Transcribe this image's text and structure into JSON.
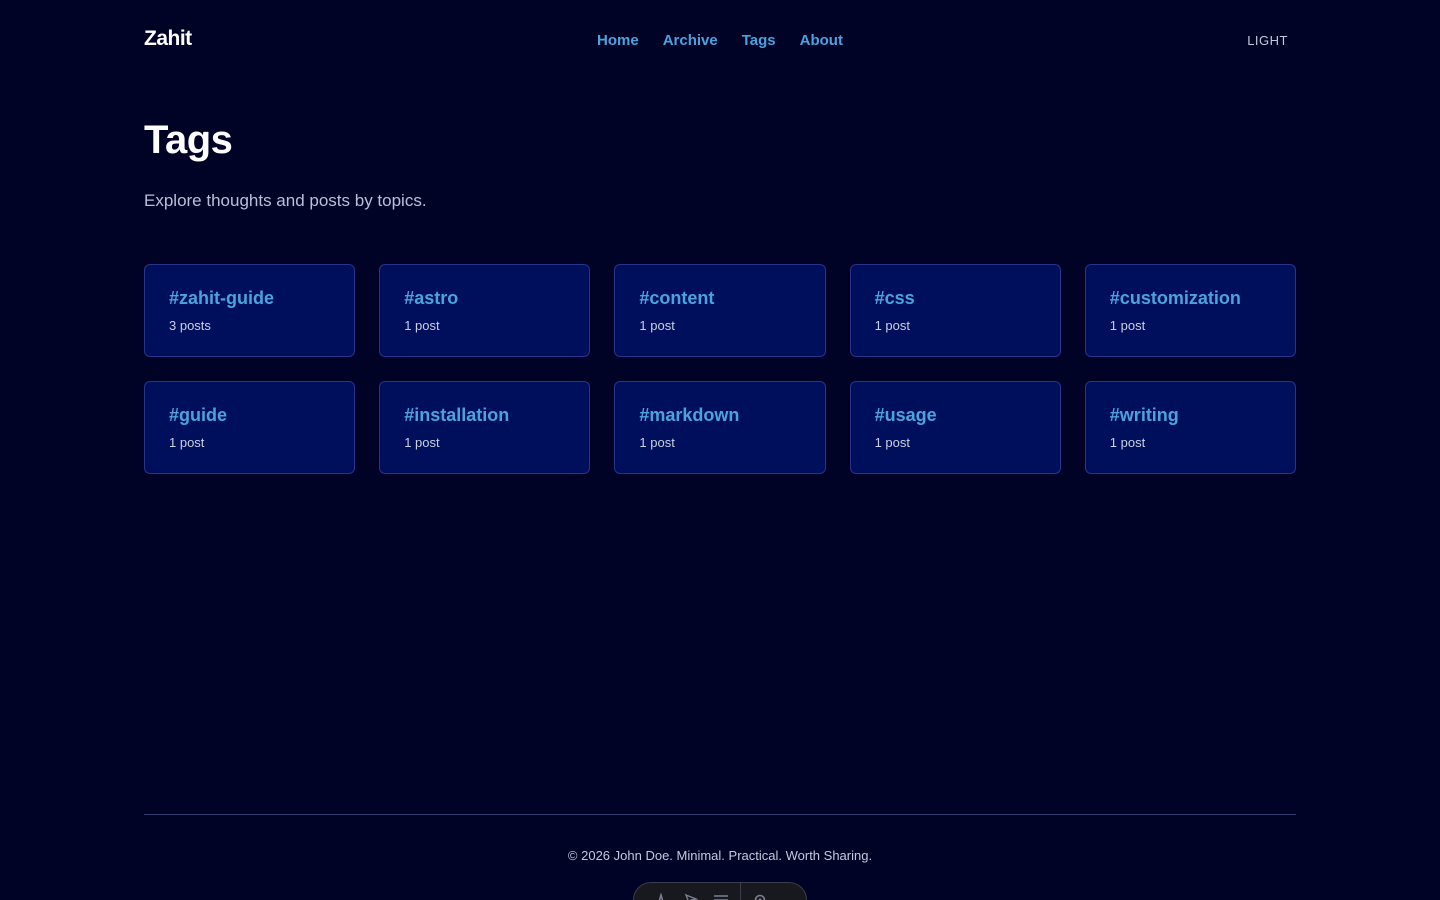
{
  "header": {
    "brand": "Zahit",
    "nav": [
      {
        "label": "Home"
      },
      {
        "label": "Archive"
      },
      {
        "label": "Tags"
      },
      {
        "label": "About"
      }
    ],
    "theme_toggle": "LIGHT"
  },
  "main": {
    "title": "Tags",
    "description": "Explore thoughts and posts by topics.",
    "tags": [
      {
        "name": "#zahit-guide",
        "count": "3 posts"
      },
      {
        "name": "#astro",
        "count": "1 post"
      },
      {
        "name": "#content",
        "count": "1 post"
      },
      {
        "name": "#css",
        "count": "1 post"
      },
      {
        "name": "#customization",
        "count": "1 post"
      },
      {
        "name": "#guide",
        "count": "1 post"
      },
      {
        "name": "#installation",
        "count": "1 post"
      },
      {
        "name": "#markdown",
        "count": "1 post"
      },
      {
        "name": "#usage",
        "count": "1 post"
      },
      {
        "name": "#writing",
        "count": "1 post"
      }
    ]
  },
  "footer": {
    "text": "© 2026 John Doe. Minimal. Practical. Worth Sharing."
  },
  "dev_toolbar": {
    "icons": [
      "astro-logo-icon",
      "inspect-icon",
      "menu-icon",
      "settings-icon"
    ]
  },
  "colors": {
    "background": "#000326",
    "card_background": "#000f5c",
    "card_border": "#28338a",
    "accent": "#4aa3df"
  }
}
